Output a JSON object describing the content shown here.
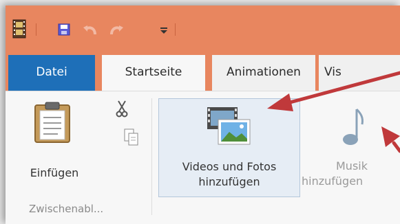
{
  "tabs": {
    "file": "Datei",
    "start": "Startseite",
    "animations": "Animationen",
    "visual": "Vis"
  },
  "ribbon": {
    "paste_label": "Einfügen",
    "clipboard_group": "Zwischenabl...",
    "add_media_line1": "Videos und Fotos",
    "add_media_line2": "hinzufügen",
    "add_music_line1": "Musik",
    "add_music_line2": "hinzufügen"
  },
  "colors": {
    "title_bar": "#e8865f",
    "file_tab": "#1e6fb8",
    "annotation_arrow": "#c0393b"
  },
  "icons": [
    "film-icon",
    "save-icon",
    "undo-icon",
    "redo-icon",
    "customize-dropdown-icon",
    "clipboard-icon",
    "cut-icon",
    "copy-icon",
    "video-photo-icon",
    "music-note-icon"
  ]
}
